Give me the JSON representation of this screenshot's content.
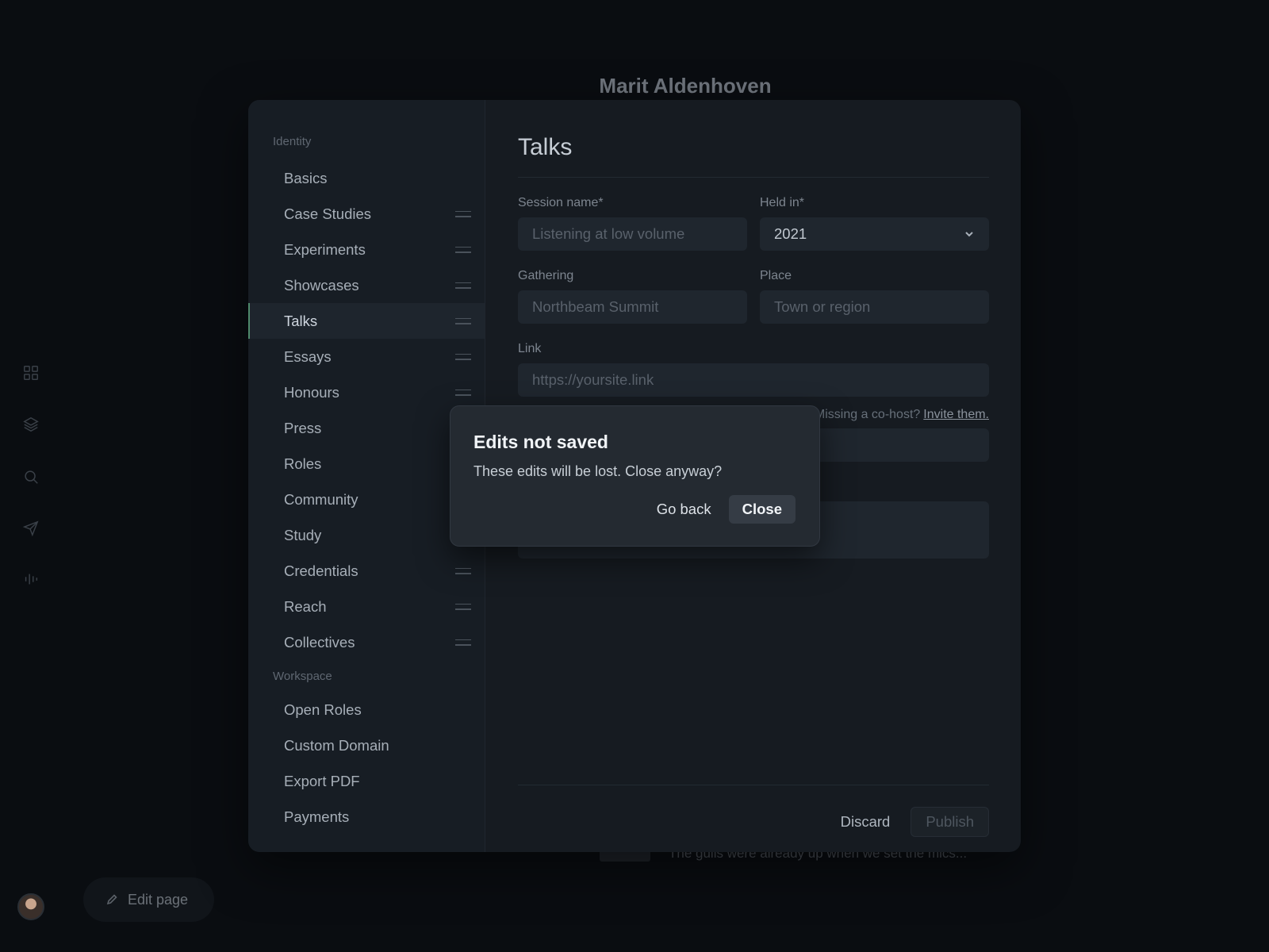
{
  "background": {
    "profile_name": "Marit Aldenhoven",
    "snippet": "The gulls were already up when we set the mics...",
    "edit_page_label": "Edit page"
  },
  "rail": {
    "icons": [
      "grid-icon",
      "layers-icon",
      "search-icon",
      "send-icon",
      "audio-bars-icon"
    ]
  },
  "nav": {
    "group_identity": "Identity",
    "identity_items": [
      {
        "label": "Basics",
        "draggable": false
      },
      {
        "label": "Case Studies",
        "draggable": true
      },
      {
        "label": "Experiments",
        "draggable": true
      },
      {
        "label": "Showcases",
        "draggable": true
      },
      {
        "label": "Talks",
        "draggable": true,
        "active": true
      },
      {
        "label": "Essays",
        "draggable": true
      },
      {
        "label": "Honours",
        "draggable": true
      },
      {
        "label": "Press",
        "draggable": true
      },
      {
        "label": "Roles",
        "draggable": true
      },
      {
        "label": "Community",
        "draggable": true
      },
      {
        "label": "Study",
        "draggable": true
      },
      {
        "label": "Credentials",
        "draggable": true
      },
      {
        "label": "Reach",
        "draggable": true
      },
      {
        "label": "Collectives",
        "draggable": true
      }
    ],
    "group_workspace": "Workspace",
    "workspace_items": [
      {
        "label": "Open Roles"
      },
      {
        "label": "Custom Domain"
      },
      {
        "label": "Export PDF"
      },
      {
        "label": "Payments"
      }
    ]
  },
  "form": {
    "title": "Talks",
    "session_name_label": "Session name*",
    "session_name_placeholder": "Listening at low volume",
    "held_in_label": "Held in*",
    "held_in_value": "2021",
    "gathering_label": "Gathering",
    "gathering_placeholder": "Northbeam Summit",
    "place_label": "Place",
    "place_placeholder": "Town or region",
    "link_label": "Link",
    "link_placeholder": "https://yoursite.link",
    "cohost_prompt": "Missing a co-host?",
    "cohost_link": "Invite them.",
    "discard_label": "Discard",
    "publish_label": "Publish"
  },
  "dialog": {
    "title": "Edits not saved",
    "body": "These edits will be lost. Close anyway?",
    "go_back_label": "Go back",
    "close_label": "Close"
  },
  "colors": {
    "accent": "#4f8a6c",
    "modal_bg": "#161b21",
    "dialog_bg": "#242a31"
  }
}
